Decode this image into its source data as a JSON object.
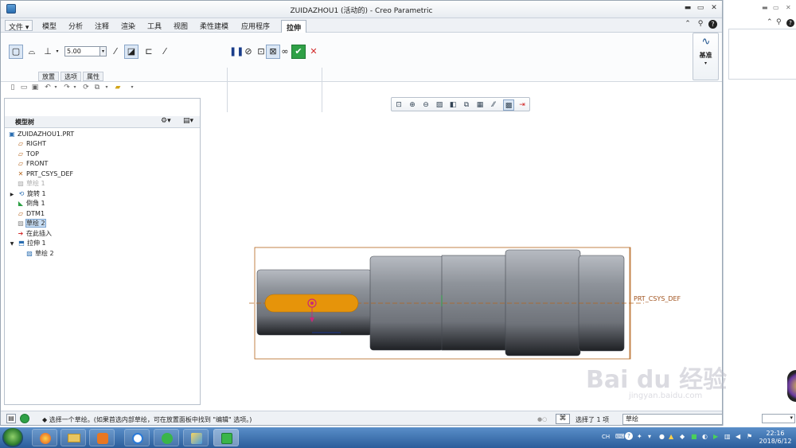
{
  "window": {
    "title": "ZUIDAZHOU1 (活动的) - Creo Parametric",
    "controls": {
      "minimize": "▬",
      "restore": "▭",
      "close": "✕"
    }
  },
  "menubar": {
    "file": "文件",
    "items": [
      "模型",
      "分析",
      "注释",
      "渲染",
      "工具",
      "视图",
      "柔性建模",
      "应用程序"
    ],
    "active_tab": "拉伸"
  },
  "ribbon": {
    "depth_value": "5.00",
    "panel_tabs": [
      "放置",
      "选项",
      "属性"
    ],
    "datum_label": "基准"
  },
  "model_tree": {
    "title": "模型树",
    "items": [
      {
        "label": "ZUIDAZHOU1.PRT",
        "icon": "part-icon",
        "state": "normal"
      },
      {
        "label": "RIGHT",
        "icon": "datum-plane-icon",
        "state": "normal"
      },
      {
        "label": "TOP",
        "icon": "datum-plane-icon",
        "state": "normal"
      },
      {
        "label": "FRONT",
        "icon": "datum-plane-icon",
        "state": "normal"
      },
      {
        "label": "PRT_CSYS_DEF",
        "icon": "csys-icon",
        "state": "normal"
      },
      {
        "label": "草绘 1",
        "icon": "sketch-icon",
        "state": "dim"
      },
      {
        "label": "旋转 1",
        "icon": "revolve-icon",
        "state": "normal"
      },
      {
        "label": "倒角 1",
        "icon": "chamfer-icon",
        "state": "normal"
      },
      {
        "label": "DTM1",
        "icon": "datum-plane-icon",
        "state": "normal"
      },
      {
        "label": "草绘 2",
        "icon": "sketch-icon",
        "state": "selected"
      },
      {
        "label": "在此插入",
        "icon": "insert-arrow-icon",
        "state": "normal"
      },
      {
        "label": "拉伸 1",
        "icon": "extrude-icon",
        "state": "normal"
      },
      {
        "label": "草绘 2",
        "icon": "sketch-icon",
        "state": "normal"
      }
    ]
  },
  "canvas": {
    "csys_label": "PRT_CSYS_DEF"
  },
  "statusbar": {
    "message": "◆ 选择一个草绘。(如果首选内部草绘，可在放置面板中找到 \"编辑\" 选项。)",
    "selection_count": "选择了 1 项",
    "filter_value": "草绘"
  },
  "taskbar": {
    "language": "CH",
    "time": "22:16",
    "date": "2018/6/12"
  },
  "watermark": {
    "brand": "Bai du 经验",
    "url": "jingyan.baidu.com"
  },
  "colors": {
    "slot_fill": "#e6940a",
    "part_gray": "#7d8188",
    "accent_blue": "#2a6db0",
    "confirm_green": "#2fa046",
    "cancel_red": "#d22a2a"
  }
}
